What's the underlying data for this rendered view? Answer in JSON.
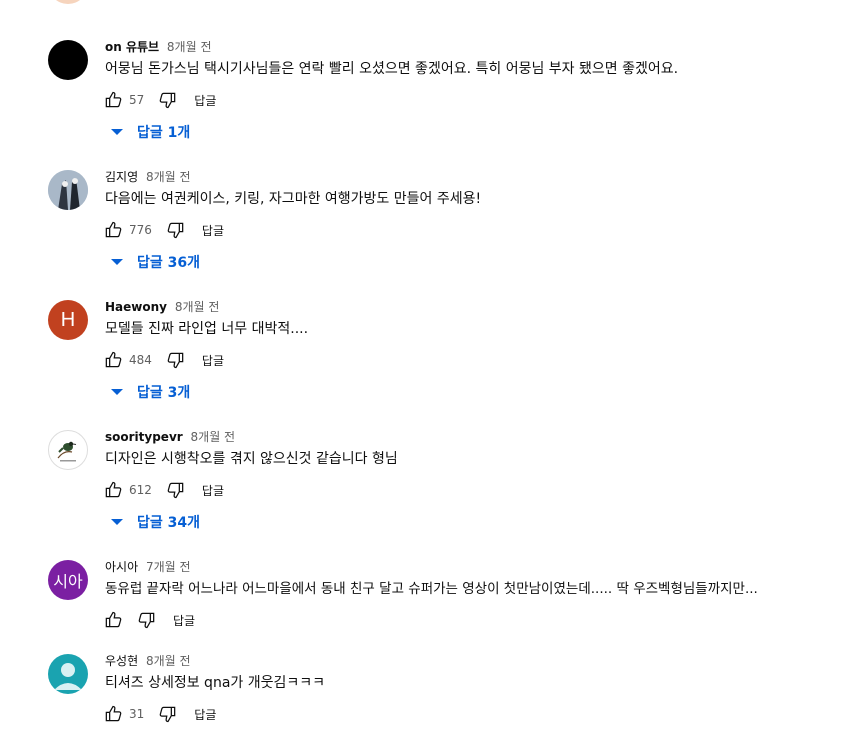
{
  "comments": [
    {
      "author": "on 유튜브",
      "time": "8개월 전",
      "text": "어뭉님 돈가스님 택시기사님들은 연락 빨리 오셨으면 좋겠어요. 특히 어뭉님 부자 됐으면 좋겠어요.",
      "likes": "57",
      "reply_label": "답글",
      "replies_label": "답글 1개"
    },
    {
      "author": "김지영",
      "time": "8개월 전",
      "text": "다음에는 여권케이스, 키링, 자그마한 여행가방도 만들어 주세용!",
      "likes": "776",
      "reply_label": "답글",
      "replies_label": "답글 36개"
    },
    {
      "author": "Haewony",
      "time": "8개월 전",
      "text": "모델들 진짜 라인업 너무 대박적....",
      "likes": "484",
      "reply_label": "답글",
      "replies_label": "답글 3개",
      "avatar_letter": "H"
    },
    {
      "author": "sooritypevr",
      "time": "8개월 전",
      "text": "디자인은 시행착오를 겪지 않으신것 같습니다 형님",
      "likes": "612",
      "reply_label": "답글",
      "replies_label": "답글 34개"
    },
    {
      "author": "아시아",
      "time": "7개월 전",
      "text": "동유럽 끝자락 어느나라 어느마을에서 동내 친구 달고 슈퍼가는 영상이 첫만남이였는데..... 딱 우즈벡형님들까지만...",
      "reply_label": "답글",
      "avatar_letter": "시아"
    },
    {
      "author": "우성현",
      "time": "8개월 전",
      "text": "티셔즈 상세정보 qna가 개웃김ㅋㅋㅋ",
      "likes": "31",
      "reply_label": "답글"
    }
  ],
  "colors": {
    "link": "#065fd4",
    "secondary": "#606060"
  },
  "icons": {
    "like": "thumb-up-icon",
    "dislike": "thumb-down-icon",
    "expand": "caret-down-icon"
  }
}
